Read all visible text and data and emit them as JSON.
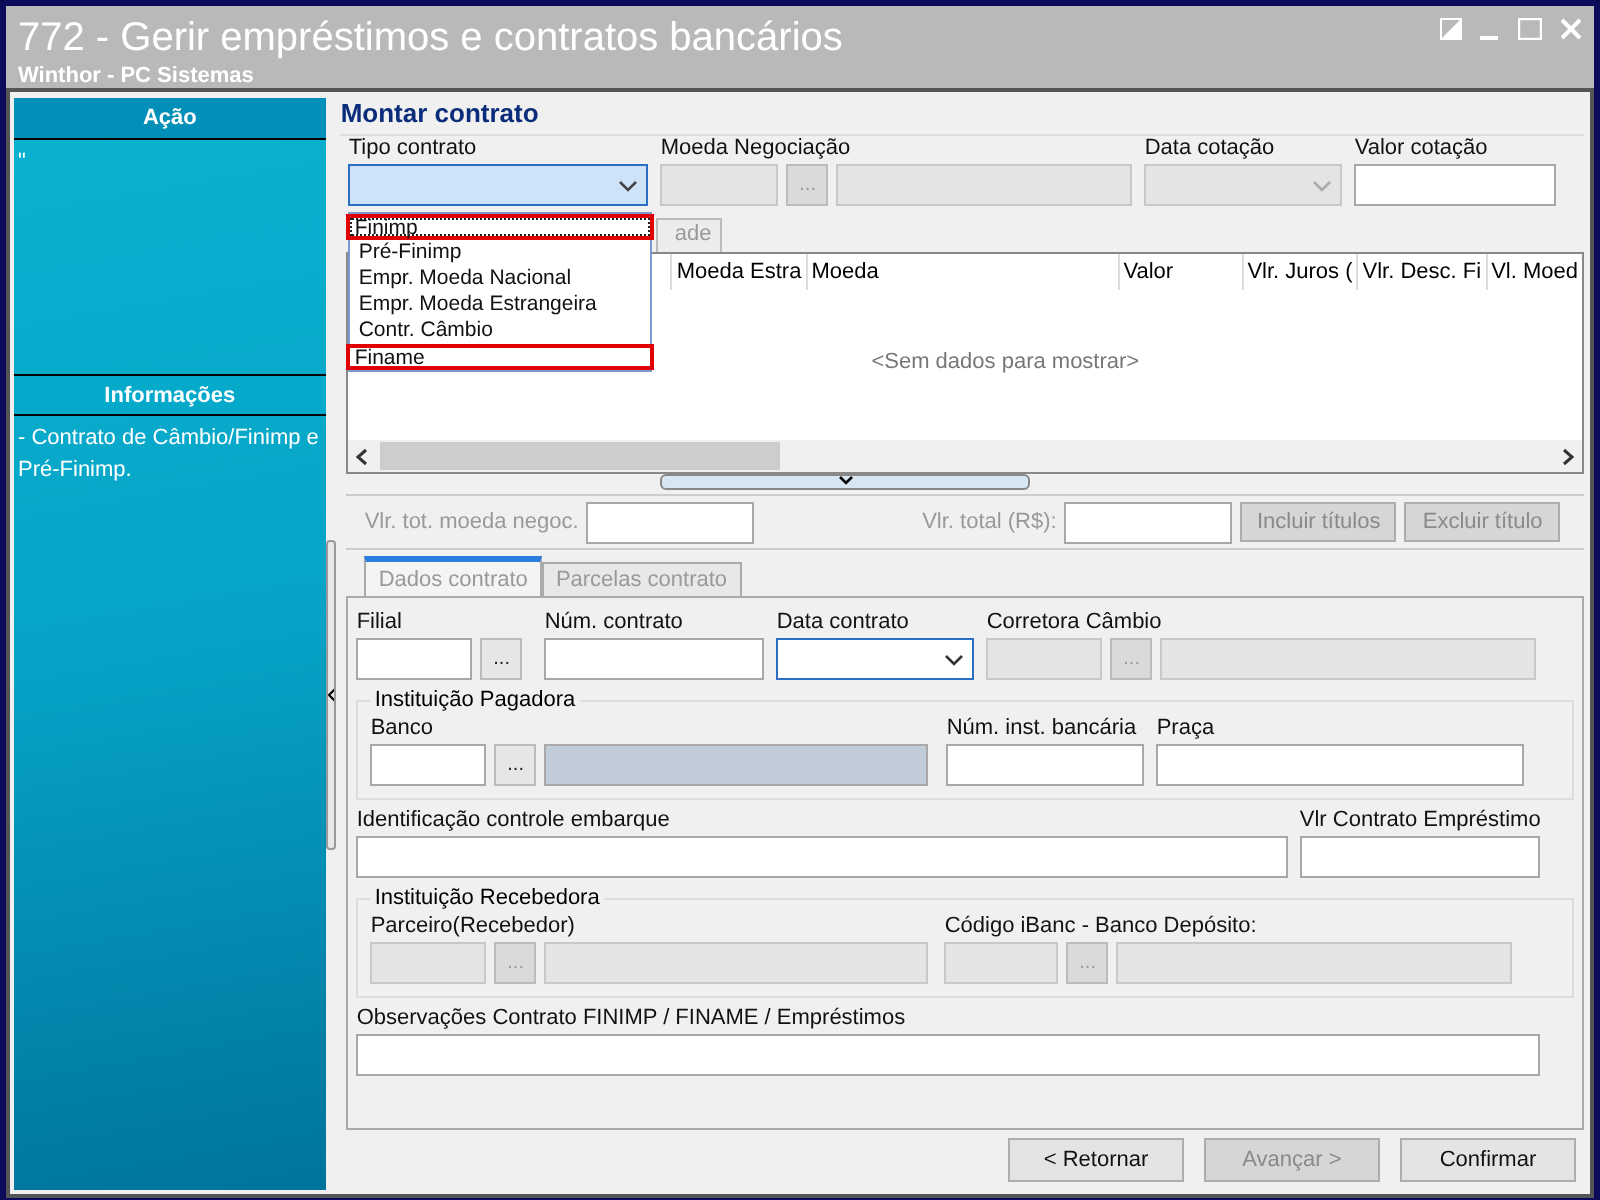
{
  "window": {
    "title": "772 - Gerir empréstimos e contratos bancários",
    "subtitle": "Winthor - PC Sistemas"
  },
  "sidebar": [
    {
      "title": "Ação",
      "text": "\""
    },
    {
      "title": "Informações",
      "text": " - Contrato de Câmbio/Finimp e Pré-Finimp."
    }
  ],
  "section_title": "Montar contrato",
  "header_fields": [
    {
      "label": "Tipo contrato",
      "kind": "dropdown",
      "expanded": true,
      "disabled": false
    },
    {
      "label": "Moeda Negociação",
      "kind": "lookup",
      "button": "...",
      "disabled": true
    },
    {
      "label": "Data cotação",
      "kind": "date",
      "disabled": true
    },
    {
      "label": "Valor cotação",
      "kind": "text",
      "disabled": false
    }
  ],
  "dropdown_options": [
    {
      "label": "Finimp",
      "selected": true,
      "highlighted": true
    },
    {
      "label": "Pré-Finimp",
      "selected": false,
      "highlighted": false
    },
    {
      "label": "Empr. Moeda Nacional",
      "selected": false,
      "highlighted": false
    },
    {
      "label": "Empr. Moeda Estrangeira",
      "selected": false,
      "highlighted": false
    },
    {
      "label": "Contr. Câmbio",
      "selected": false,
      "highlighted": false
    },
    {
      "label": "Finame",
      "selected": false,
      "highlighted": true
    }
  ],
  "grid": {
    "tab_fragment": "ade",
    "columns": [
      "Moeda Estra",
      "Moeda",
      "Valor",
      "Vlr. Juros (",
      "Vlr. Desc. Fi",
      "Vl. Moed"
    ],
    "empty_text": "<Sem dados para mostrar>"
  },
  "totals": {
    "fields": [
      {
        "label": "Vlr. tot. moeda negoc."
      },
      {
        "label": "Vlr. total (R$):"
      }
    ],
    "buttons": [
      {
        "label": "Incluir títulos",
        "disabled": true
      },
      {
        "label": "Excluir título",
        "disabled": true
      }
    ]
  },
  "tabs": [
    {
      "label": "Dados contrato",
      "selected": true
    },
    {
      "label": "Parcelas contrato",
      "selected": false
    }
  ],
  "form": {
    "row1": [
      {
        "label": "Filial",
        "kind": "lookup_short",
        "button": "...",
        "disabled": false
      },
      {
        "label": "Núm. contrato",
        "kind": "text",
        "disabled": false
      },
      {
        "label": "Data contrato",
        "kind": "date",
        "disabled": false
      },
      {
        "label": "Corretora Câmbio",
        "kind": "lookup",
        "button": "...",
        "disabled": true
      }
    ],
    "payer_group": {
      "title": "Instituição Pagadora",
      "fields": [
        {
          "label": "Banco",
          "kind": "lookup",
          "button": "...",
          "disabled": false
        },
        {
          "label": "Núm. inst. bancária",
          "kind": "text",
          "disabled": false
        },
        {
          "label": "Praça",
          "kind": "text",
          "disabled": false
        }
      ]
    },
    "shipment_label": "Identificação controle embarque",
    "loan_value_label": "Vlr Contrato Empréstimo",
    "receiver_group": {
      "title": "Instituição Recebedora",
      "fields": [
        {
          "label": "Parceiro(Recebedor)",
          "kind": "lookup",
          "button": "...",
          "disabled": true
        },
        {
          "label": "Código iBanc - Banco Depósito:",
          "kind": "lookup",
          "button": "...",
          "disabled": true
        }
      ]
    },
    "notes_label": "Observações Contrato FINIMP / FINAME / Empréstimos"
  },
  "footer_buttons": [
    {
      "label": "< Retornar",
      "disabled": false
    },
    {
      "label": "Avançar >",
      "disabled": true
    },
    {
      "label": "Confirmar",
      "disabled": false
    }
  ]
}
